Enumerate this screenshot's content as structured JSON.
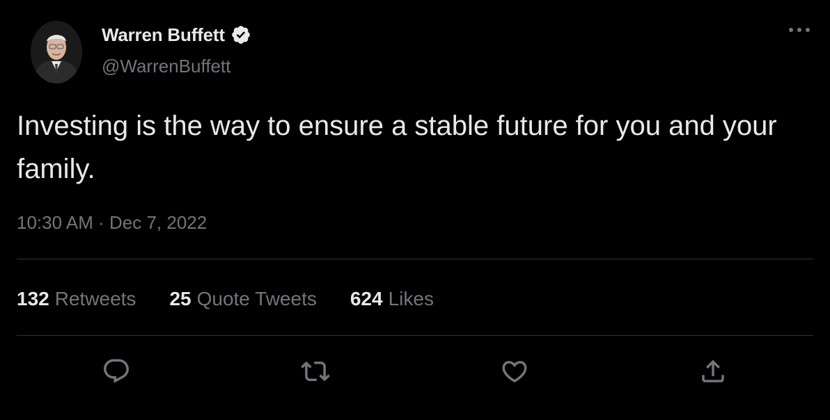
{
  "tweet": {
    "author": {
      "display_name": "Warren Buffett",
      "handle": "@WarrenBuffett",
      "verified": true
    },
    "text": "Investing is the way to ensure a stable future for you and your family.",
    "timestamp": {
      "time": "10:30 AM",
      "separator": "·",
      "date": "Dec 7, 2022"
    },
    "stats": {
      "retweets": {
        "count": "132",
        "label": "Retweets"
      },
      "quote_tweets": {
        "count": "25",
        "label": "Quote Tweets"
      },
      "likes": {
        "count": "624",
        "label": "Likes"
      }
    },
    "actions": [
      "reply-icon",
      "retweet-icon",
      "like-icon",
      "share-icon"
    ]
  },
  "colors": {
    "background": "#000000",
    "primary_text": "#e7e9ea",
    "secondary_text": "#71767b",
    "divider": "#2f3336"
  }
}
